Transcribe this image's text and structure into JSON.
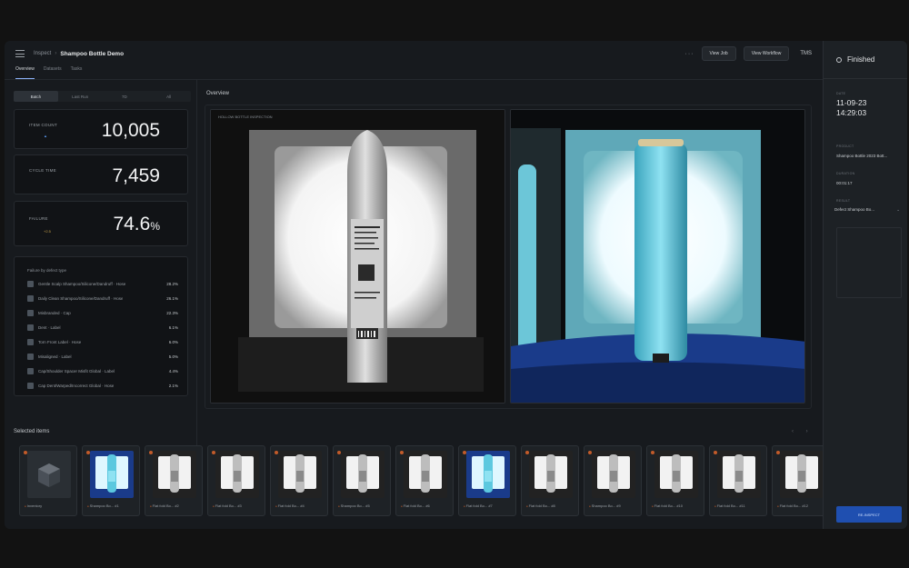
{
  "header": {
    "breadcrumb_root": "Inspect",
    "breadcrumb_current": "Shampoo Bottle Demo",
    "more_label": "···",
    "buttons": [
      "View Job",
      "View Workflow"
    ],
    "user_label": "TMS"
  },
  "tabs": [
    {
      "label": "Overview",
      "active": true
    },
    {
      "label": "Datasets",
      "active": false
    },
    {
      "label": "Tasks",
      "active": false
    }
  ],
  "segmented": [
    "Batch",
    "Last Run",
    "7D",
    "All"
  ],
  "stats": [
    {
      "label": "ITEM COUNT",
      "value": "10,005",
      "unit": "",
      "sub": "▲"
    },
    {
      "label": "CYCLE TIME",
      "value": "7,459",
      "unit": "",
      "sub": ""
    },
    {
      "label": "FAILURE",
      "value": "74.6",
      "unit": "%",
      "sub": "+2.5"
    }
  ],
  "tiers": {
    "title": "Failure by defect type",
    "rows": [
      {
        "name": "Gentle Scalp Shampoo/Silicone/Dandruff · Hose",
        "value": "28.2%"
      },
      {
        "name": "Daily Clean Shampoo/Silicone/Dandruff · Hose",
        "value": "26.1%"
      },
      {
        "name": "Misbranded · Cap",
        "value": "22.3%"
      },
      {
        "name": "Dent · Label",
        "value": "6.1%"
      },
      {
        "name": "Torn Front Label · Hose",
        "value": "6.0%"
      },
      {
        "name": "Misaligned · Label",
        "value": "5.0%"
      },
      {
        "name": "Cap/Shoulder Spacer Misfit Global · Label",
        "value": "4.4%"
      },
      {
        "name": "Cap Dent/Warped/Incorrect Global · Hose",
        "value": "2.1%"
      }
    ]
  },
  "overview": {
    "title": "Overview",
    "camera_label": "HOLLOW BOTTLE INSPECTION"
  },
  "selected": {
    "title": "Selected items",
    "arrows": "‹ ›",
    "items": [
      {
        "label": "Inventory",
        "tag": "",
        "kind": "cube"
      },
      {
        "label": "Shampoo Bo... #1",
        "tag": "",
        "kind": "blue"
      },
      {
        "label": "Flat fold Bo... #2",
        "tag": "",
        "kind": "bw"
      },
      {
        "label": "Flat fold Bo... #3",
        "tag": "",
        "kind": "bw"
      },
      {
        "label": "Flat fold Bo... #4",
        "tag": "",
        "kind": "bw"
      },
      {
        "label": "Shampoo Bo... #5",
        "tag": "",
        "kind": "bw"
      },
      {
        "label": "Flat fold Bo... #6",
        "tag": "",
        "kind": "bw"
      },
      {
        "label": "Flat fold Bo... #7",
        "tag": "",
        "kind": "blue"
      },
      {
        "label": "Flat fold Bo... #8",
        "tag": "",
        "kind": "bw"
      },
      {
        "label": "Shampoo Bo... #9",
        "tag": "",
        "kind": "bw"
      },
      {
        "label": "Flat fold Bo... #10",
        "tag": "",
        "kind": "bw"
      },
      {
        "label": "Flat fold Bo... #11",
        "tag": "",
        "kind": "bw"
      },
      {
        "label": "Flat fold Bo... #12",
        "tag": "",
        "kind": "bw"
      }
    ]
  },
  "sidebar": {
    "status": "Finished",
    "date_label": "DATE",
    "date_line1": "11-09-23",
    "date_line2": "14:29:03",
    "product_label": "PRODUCT",
    "product_value": "Shampoo Bottle 2023 Bott...",
    "duration_label": "DURATION",
    "duration_value": "00:01:17",
    "result_label": "RESULT",
    "result_value": "Defect Shampoo Bo...",
    "result_chevron": "⌄",
    "action_label": "RE-INSPECT"
  },
  "colors": {
    "accent": "#1f4fb0",
    "tab_underline": "#8fb6ff",
    "defect_dot": "#c25b2a"
  }
}
